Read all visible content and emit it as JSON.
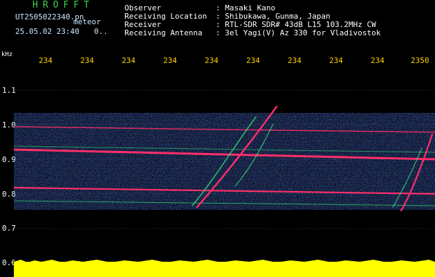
{
  "header": {
    "brand": "HROFFT",
    "filename": "UT2505022340.pn",
    "filetype": "meteor",
    "date": "25.05.02 23:40",
    "date_suffix": "0..",
    "meta": [
      {
        "key": "Observer",
        "value": ": Masaki Kano"
      },
      {
        "key": "Receiving Location",
        "value": ": Shibukawa, Gunma, Japan"
      },
      {
        "key": "Receiver",
        "value": ": RTL-SDR SDR# 43dB L15 103.2MHz CW"
      },
      {
        "key": "Receiving Antenna",
        "value": ": 3el Yagi(V) Az 330 for Vladivostok"
      }
    ]
  },
  "axes": {
    "y_unit": "kHz",
    "x_ticks": [
      "234",
      "234",
      "234",
      "234",
      "234",
      "234",
      "234",
      "234",
      "234",
      "2350"
    ],
    "y_ticks": [
      "1.1",
      "1.0",
      "0.9",
      "0.8",
      "0.7",
      "0.6"
    ]
  },
  "colors": {
    "background": "#000000",
    "noise_blue": "#1a2cff",
    "signal_green": "#35e07a",
    "signal_red": "#ff2f6a",
    "level_yellow": "#ffff00"
  }
}
